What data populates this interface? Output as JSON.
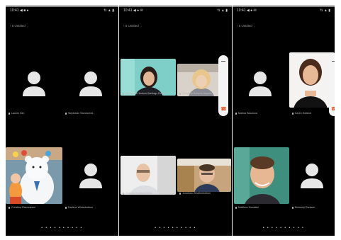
{
  "panels": [
    {
      "status_time": "10:41 ◀ ■ ●",
      "status_right": "⇅ ▲ ▮",
      "header": "‹ 5 Untitled",
      "tiles": [
        {
          "name": "Lauren Kim",
          "type": "avatar"
        },
        {
          "name": "Stephanie Stonecreek",
          "type": "avatar"
        },
        {
          "name": "Christina Rasmussen",
          "type": "video"
        },
        {
          "name": "Darlene Winterbottom",
          "type": "avatar"
        }
      ],
      "dots": "• • • • • • • • • •"
    },
    {
      "status_time": "10:41 ◀ ● ✉",
      "status_right": "⇅ ▲ ▮",
      "header": "‹ 5 Untitled",
      "tiles": [
        {
          "name": "Samantha Hudson-Santiago Ronan",
          "type": "video"
        },
        {
          "name": "Elizabeth Roberts-Haynes",
          "type": "video"
        },
        {
          "name": "Graham Goldfarb-White",
          "type": "video"
        },
        {
          "name": "Jonathan Weatherbottom",
          "type": "video"
        }
      ],
      "dots": "• • • • • • • • • •"
    },
    {
      "status_time": "10:41 ◀ ● ✉",
      "status_right": "⇅ ▲ ▮",
      "header": "‹ 5 Untitled",
      "tiles": [
        {
          "name": "Marina Sokolova",
          "type": "avatar"
        },
        {
          "name": "Karen Holland",
          "type": "video"
        },
        {
          "name": "Matthew Kowalski",
          "type": "video"
        },
        {
          "name": "Kimberly Ransom",
          "type": "avatar"
        }
      ],
      "dots": "• • • • • • • • • •"
    }
  ],
  "colors": {
    "background": "#000000",
    "avatar": "#e6e6e6",
    "hangup": "#e64a19"
  }
}
